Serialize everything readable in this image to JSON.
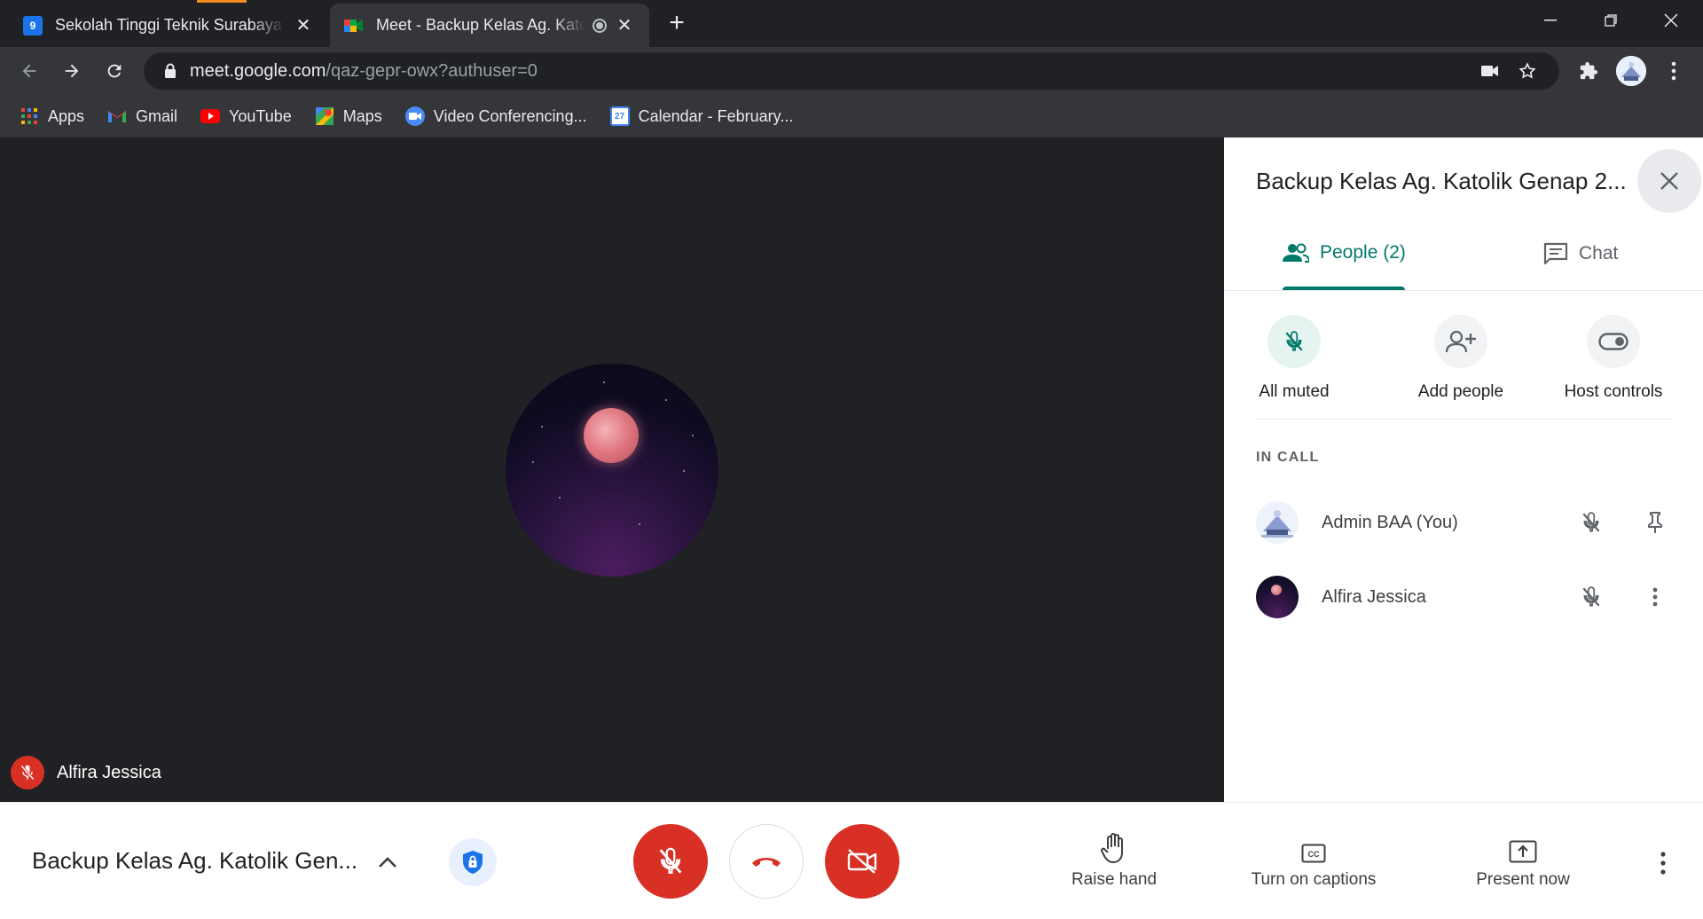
{
  "browser": {
    "tabs": [
      {
        "title": "Sekolah Tinggi Teknik Surabaya - ",
        "favicon": "calendar-9-icon",
        "favicon_text": "9",
        "active": false
      },
      {
        "title": "Meet - Backup Kelas Ag. Katolik",
        "favicon": "google-meet-icon",
        "active": true
      }
    ],
    "address": {
      "host": "meet.google.com",
      "path": "/qaz-gepr-owx?authuser=0"
    },
    "bookmarks": [
      {
        "label": "Apps",
        "icon": "apps-grid-icon"
      },
      {
        "label": "Gmail",
        "icon": "gmail-icon"
      },
      {
        "label": "YouTube",
        "icon": "youtube-icon"
      },
      {
        "label": "Maps",
        "icon": "maps-icon"
      },
      {
        "label": "Video Conferencing...",
        "icon": "video-conferencing-icon"
      },
      {
        "label": "Calendar - February...",
        "icon": "calendar-icon",
        "icon_text": "27"
      }
    ]
  },
  "stage": {
    "speaker_name": "Alfira Jessica"
  },
  "panel": {
    "title": "Backup Kelas Ag. Katolik Genap 2...",
    "tabs": {
      "people": "People (2)",
      "chat": "Chat"
    },
    "actions": {
      "all_muted": "All muted",
      "add_people": "Add people",
      "host_controls": "Host controls"
    },
    "section_label": "IN CALL",
    "participants": [
      {
        "name": "Admin BAA (You)",
        "muted": true,
        "secondary_icon": "pin-icon"
      },
      {
        "name": "Alfira Jessica",
        "muted": true,
        "secondary_icon": "more-vert-icon"
      }
    ]
  },
  "bottom": {
    "meeting_name": "Backup Kelas Ag. Katolik Gen...",
    "buttons": {
      "raise_hand": "Raise hand",
      "captions": "Turn on captions",
      "present": "Present now"
    }
  },
  "colors": {
    "accent": "#00796b",
    "danger": "#d93025",
    "dark_bg": "#202124"
  }
}
